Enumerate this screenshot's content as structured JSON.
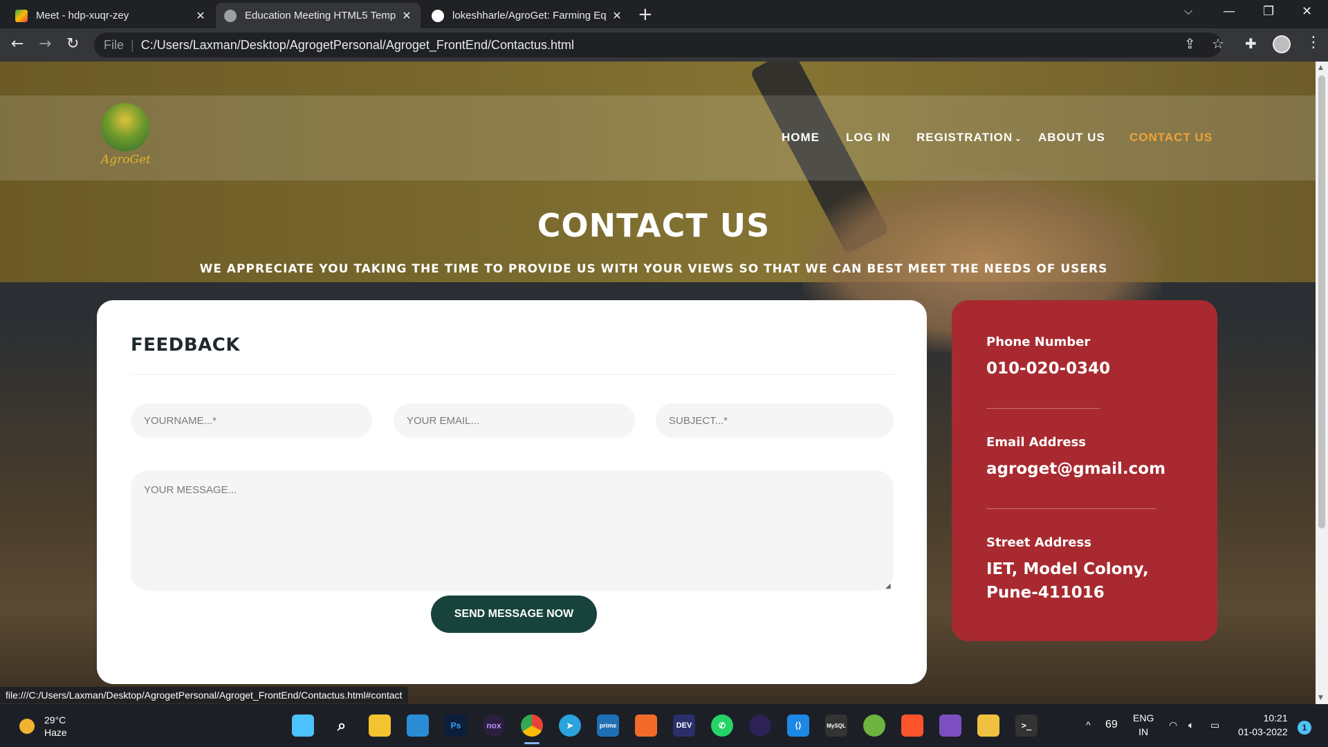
{
  "browser": {
    "tabs": [
      {
        "title": "Meet - hdp-xuqr-zey",
        "active": false
      },
      {
        "title": "Education Meeting HTML5 Templ",
        "active": true
      },
      {
        "title": "lokeshharle/AgroGet: Farming Eq",
        "active": false
      }
    ],
    "new_tab": "+",
    "window_controls": {
      "minimize": "—",
      "restore": "❐",
      "close": "✕"
    },
    "address": {
      "scheme_label": "File",
      "url": "C:/Users/Laxman/Desktop/AgrogetPersonal/Agroget_FrontEnd/Contactus.html"
    },
    "status_url": "file:///C:/Users/Laxman/Desktop/AgrogetPersonal/Agroget_FrontEnd/Contactus.html#contact"
  },
  "site": {
    "logo_text": "AgroGet",
    "nav": [
      {
        "label": "HOME",
        "active": false
      },
      {
        "label": "LOG IN",
        "active": false
      },
      {
        "label": "REGISTRATION",
        "active": false,
        "has_dropdown": true
      },
      {
        "label": "ABOUT US",
        "active": false
      },
      {
        "label": "CONTACT US",
        "active": true
      }
    ],
    "hero": {
      "title": "CONTACT US",
      "subtitle": "WE APPRECIATE YOU TAKING THE TIME TO PROVIDE US WITH YOUR VIEWS SO THAT WE CAN BEST MEET THE NEEDS OF USERS"
    },
    "feedback": {
      "heading": "FEEDBACK",
      "name_placeholder": "YOURNAME...*",
      "email_placeholder": "YOUR EMAIL...",
      "subject_placeholder": "SUBJECT...*",
      "message_placeholder": "YOUR MESSAGE...",
      "send_label": "SEND MESSAGE NOW"
    },
    "contact": {
      "phone_label": "Phone Number",
      "phone": "010-020-0340",
      "email_label": "Email Address",
      "email": "agroget@gmail.com",
      "street_label": "Street Address",
      "street_line1": "IET, Model Colony,",
      "street_line2": "Pune-411016"
    }
  },
  "taskbar": {
    "weather_temp": "29°C",
    "weather_desc": "Haze",
    "tray_count": "69",
    "lang": "ENG",
    "region": "IN",
    "time": "10:21",
    "date": "01-03-2022",
    "notifications": "1"
  },
  "colors": {
    "accent_nav": "#f2a23b",
    "send_button": "#18433c",
    "contact_card": "#a82a30"
  }
}
